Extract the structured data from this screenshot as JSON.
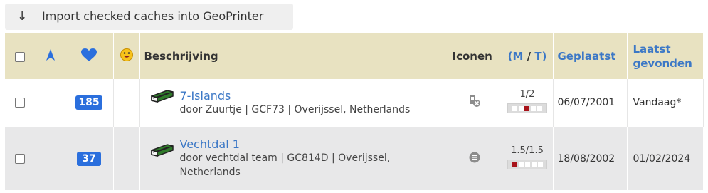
{
  "toolbar": {
    "import_arrow": "↓",
    "import_label": "Import checked caches into GeoPrinter"
  },
  "table": {
    "headers": {
      "description": "Beschrijving",
      "icons": "Iconen",
      "dt_open": "(",
      "dt_m": "M",
      "dt_sep": " / ",
      "dt_t": "T",
      "dt_close": ")",
      "placed": "Geplaatst",
      "last_found_1": "Laatst",
      "last_found_2": "gevonden"
    },
    "rows": [
      {
        "favorites": "185",
        "name": "7-Islands",
        "details": "door Zuurtje | GCF73 | Overijssel, Netherlands",
        "dt": "1/2",
        "difficulty": 1,
        "terrain": 2,
        "placed": "06/07/2001",
        "last_found": "Vandaag*",
        "attribute_icon": "no-boat-icon"
      },
      {
        "favorites": "37",
        "name": "Vechtdal 1",
        "details": "door vechtdal team | GC814D | Overijssel, Netherlands",
        "dt": "1.5/1.5",
        "difficulty": 1.5,
        "terrain": 1.5,
        "placed": "18/08/2002",
        "last_found": "01/02/2024",
        "attribute_icon": "badge-icon"
      }
    ]
  },
  "colors": {
    "header_bg": "#e8e2c1",
    "link_blue": "#3c78c6",
    "badge_blue": "#2b6fdd",
    "row_alt_bg": "#e8e8e9",
    "dt_red": "#a8131a"
  }
}
